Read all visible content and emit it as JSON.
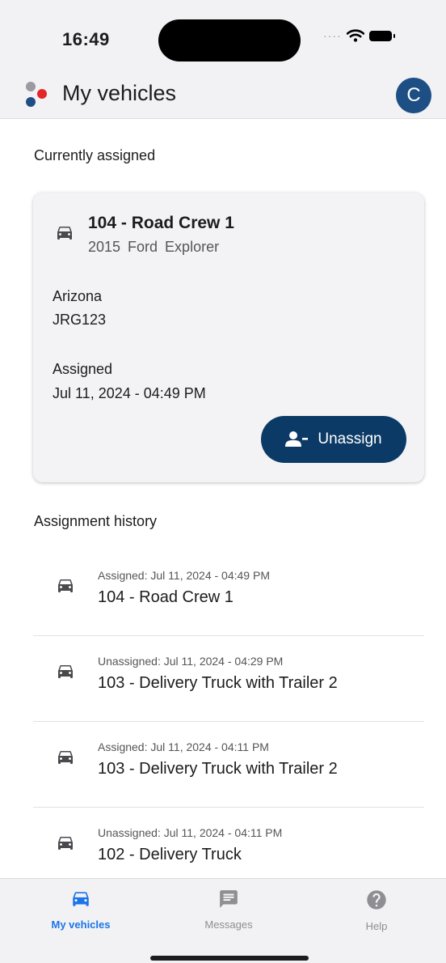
{
  "status_bar": {
    "time": "16:49"
  },
  "header": {
    "title": "My vehicles",
    "avatar_letter": "C"
  },
  "current": {
    "section_title": "Currently assigned",
    "vehicle_name": "104 - Road Crew 1",
    "vehicle_model": "2015 Ford Explorer",
    "state": "Arizona",
    "plate": "JRG123",
    "assigned_label": "Assigned",
    "assigned_date": "Jul 11, 2024 - 04:49 PM",
    "unassign_label": "Unassign"
  },
  "history": {
    "section_title": "Assignment history",
    "items": [
      {
        "status": "Assigned: Jul 11, 2024 - 04:49 PM",
        "name": "104 - Road Crew 1"
      },
      {
        "status": "Unassigned: Jul 11, 2024 - 04:29 PM",
        "name": "103 - Delivery Truck with Trailer 2"
      },
      {
        "status": "Assigned: Jul 11, 2024 - 04:11 PM",
        "name": "103 - Delivery Truck with Trailer 2"
      },
      {
        "status": "Unassigned: Jul 11, 2024 - 04:11 PM",
        "name": "102 - Delivery Truck"
      }
    ]
  },
  "tabs": [
    {
      "label": "My vehicles",
      "icon": "car-icon",
      "active": true
    },
    {
      "label": "Messages",
      "icon": "message-icon",
      "active": false
    },
    {
      "label": "Help",
      "icon": "help-icon",
      "active": false
    }
  ],
  "colors": {
    "accent": "#1c74e8",
    "button": "#0c3a66",
    "avatar": "#1d4f85",
    "logo_red": "#e5252a",
    "logo_blue": "#1d4f85",
    "logo_gray": "#9a9aa0"
  }
}
